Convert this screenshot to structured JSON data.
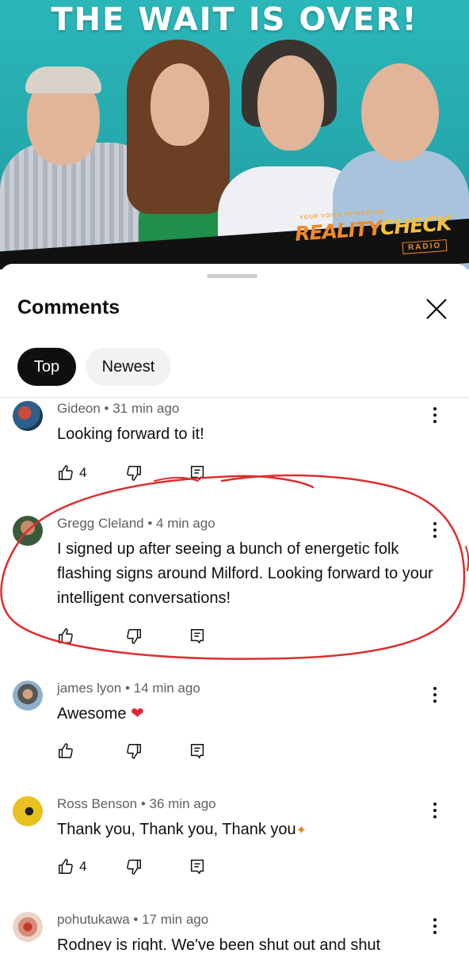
{
  "banner": {
    "title": "THE WAIT IS OVER!",
    "logo_tagline": "YOUR VOICE OF REASON",
    "logo_part1": "REALITY",
    "logo_part2": "CHECK",
    "logo_sub": "RADIO"
  },
  "sheet": {
    "title": "Comments",
    "chips": {
      "top": "Top",
      "newest": "Newest"
    }
  },
  "comments": [
    {
      "meta": "Gideon • 31 min ago",
      "text": "Looking forward to it!",
      "likes": "4"
    },
    {
      "meta": "Gregg Cleland • 4 min ago",
      "text": "I signed up after seeing a bunch of energetic folk flashing signs around Milford. Looking forward to your intelligent conversations!",
      "likes": ""
    },
    {
      "meta": "james lyon • 14 min ago",
      "text": "Awesome",
      "likes": ""
    },
    {
      "meta": "Ross Benson • 36 min ago",
      "text": "Thank you, Thank you, Thank you",
      "likes": "4"
    },
    {
      "meta": "pohutukawa • 17 min ago",
      "text": "Rodney is right. We've been shut out and shut",
      "likes": ""
    }
  ],
  "colors": {
    "brand_orange": "#f08a24",
    "banner_teal": "#2bb7b9",
    "annotation_red": "#d9302f",
    "heart": "#e1262f"
  }
}
